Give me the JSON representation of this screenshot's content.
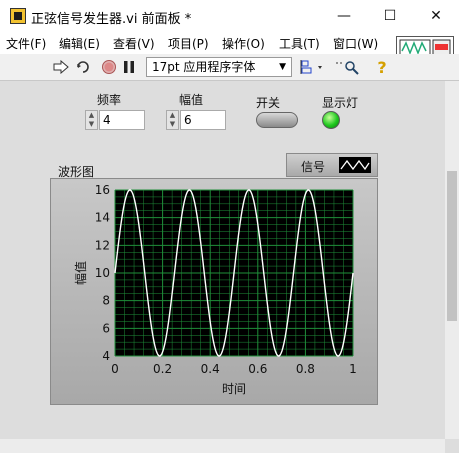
{
  "window": {
    "title": "正弦信号发生器.vi 前面板 *",
    "minimize_glyph": "—",
    "maximize_glyph": "☐",
    "close_glyph": "✕"
  },
  "menu": [
    "文件(F)",
    "编辑(E)",
    "查看(V)",
    "项目(P)",
    "操作(O)",
    "工具(T)",
    "窗口(W)"
  ],
  "toolbar": {
    "run_icon": "run-arrow-icon",
    "run_continuous_icon": "run-continuously-icon",
    "abort_icon": "abort-icon",
    "pause_icon": "pause-icon",
    "font_select": "17pt 应用程序字体",
    "help_glyph": "?"
  },
  "controls": {
    "frequency_label": "频率",
    "frequency_value": "4",
    "amplitude_label": "幅值",
    "amplitude_value": "6",
    "switch_label": "开关",
    "switch_state": "off",
    "led_label": "显示灯",
    "led_state": "on",
    "led_color": "#22cc22"
  },
  "graph": {
    "label": "波形图",
    "legend_name": "信号",
    "plot_bg": "#000000",
    "grid_color": "#1f8f3a",
    "line_color": "#ffffff"
  },
  "chart_data": {
    "type": "line",
    "xlabel": "时间",
    "ylabel": "幅值",
    "xlim": [
      0,
      1
    ],
    "ylim": [
      4,
      16
    ],
    "x_ticks": [
      "0",
      "0.2",
      "0.4",
      "0.6",
      "0.8",
      "1"
    ],
    "y_ticks": [
      "4",
      "6",
      "8",
      "10",
      "12",
      "14",
      "16"
    ],
    "grid": true,
    "series": [
      {
        "name": "信号",
        "function": "10 + 6*sin(2*pi*4*t)",
        "frequency": 4,
        "amplitude": 6,
        "offset": 10
      }
    ]
  }
}
